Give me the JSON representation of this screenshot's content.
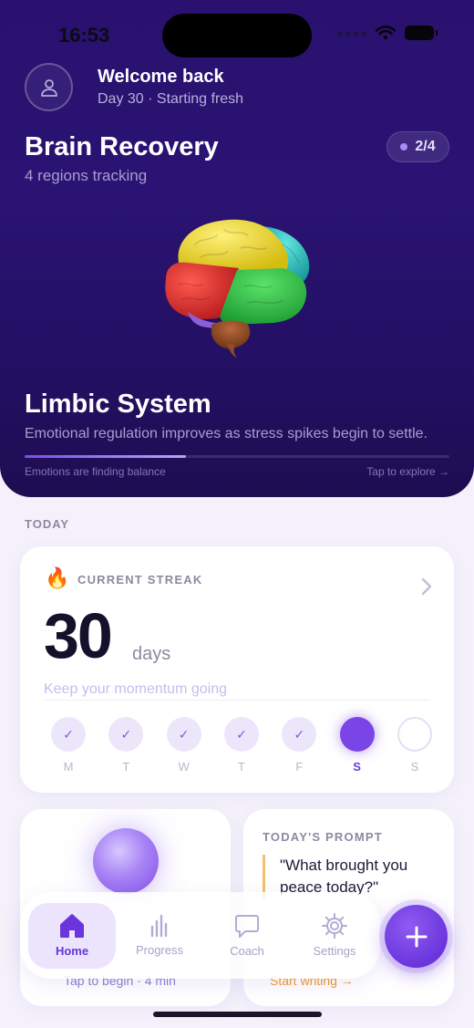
{
  "status": {
    "time": "16:53"
  },
  "header": {
    "welcome": "Welcome back",
    "day_subtitle": "Day 30 · Starting fresh",
    "title": "Brain Recovery",
    "regions_tracking": "4 regions tracking",
    "badge": "2/4"
  },
  "region": {
    "name": "Limbic System",
    "description": "Emotional regulation improves as stress spikes begin to settle.",
    "progress": 0.38,
    "footer_left": "Emotions are finding balance",
    "footer_right": "Tap to explore →"
  },
  "today": {
    "section_label": "TODAY",
    "streak": {
      "label": "CURRENT STREAK",
      "value": "30",
      "unit": "days",
      "subtitle": "Keep your momentum going",
      "week": [
        {
          "label": "M",
          "state": "done"
        },
        {
          "label": "T",
          "state": "done"
        },
        {
          "label": "W",
          "state": "done"
        },
        {
          "label": "T",
          "state": "done"
        },
        {
          "label": "F",
          "state": "done"
        },
        {
          "label": "S",
          "state": "current"
        },
        {
          "label": "S",
          "state": "upcoming"
        }
      ]
    },
    "breathe_card": {
      "action": "Tap to begin · 4 min"
    },
    "prompt_card": {
      "label": "TODAY'S PROMPT",
      "quote": "\"What brought you peace today?\"",
      "action": "Start writing →"
    }
  },
  "tabbar": {
    "tabs": [
      {
        "label": "Home",
        "icon": "home-icon",
        "active": true
      },
      {
        "label": "Progress",
        "icon": "bar-chart-icon",
        "active": false
      },
      {
        "label": "Coach",
        "icon": "chat-bubble-icon",
        "active": false
      },
      {
        "label": "Settings",
        "icon": "gear-icon",
        "active": false
      }
    ],
    "fab_icon": "plus-icon"
  },
  "colors": {
    "accent": "#7a45e6",
    "hero_bg": "#2a1170",
    "prompt_accent": "#f09a32"
  }
}
